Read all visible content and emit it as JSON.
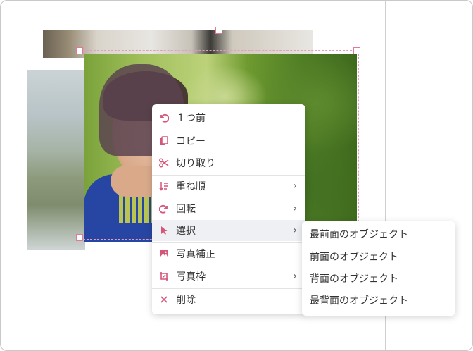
{
  "context_menu": {
    "items": [
      {
        "label": "１つ前",
        "icon": "undo-icon",
        "has_submenu": false
      },
      {
        "label": "コピー",
        "icon": "copy-icon",
        "has_submenu": false
      },
      {
        "label": "切り取り",
        "icon": "scissors-icon",
        "has_submenu": false
      },
      {
        "label": "重ね順",
        "icon": "sort-order-icon",
        "has_submenu": true
      },
      {
        "label": "回転",
        "icon": "rotate-icon",
        "has_submenu": true
      },
      {
        "label": "選択",
        "icon": "cursor-icon",
        "has_submenu": true,
        "active": true
      },
      {
        "label": "写真補正",
        "icon": "image-adjust-icon",
        "has_submenu": false
      },
      {
        "label": "写真枠",
        "icon": "crop-frame-icon",
        "has_submenu": true
      },
      {
        "label": "削除",
        "icon": "close-icon",
        "has_submenu": false
      }
    ],
    "submenu_arrow": "›"
  },
  "submenu": {
    "items": [
      {
        "label": "最前面のオブジェクト"
      },
      {
        "label": "前面のオブジェクト"
      },
      {
        "label": "背面のオブジェクト"
      },
      {
        "label": "最背面のオブジェクト"
      }
    ]
  },
  "colors": {
    "accent": "#d6557a",
    "selection": "#e59db3",
    "active_row": "#eef0f4"
  }
}
